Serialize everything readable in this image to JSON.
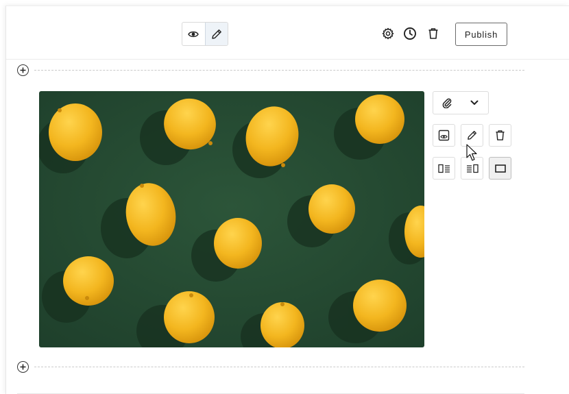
{
  "toolbar": {
    "publish_label": "Publish",
    "mode": "edit"
  },
  "icons": {
    "preview": "eye-icon",
    "edit": "pencil-icon",
    "settings": "gear-icon",
    "history": "clock-icon",
    "delete": "trash-icon",
    "add_block": "plus-circle-icon",
    "attachment": "paperclip-icon",
    "dropdown": "chevron-down-icon",
    "image_preview": "image-preview-icon",
    "image_edit": "pencil-icon",
    "image_delete": "trash-icon",
    "layout_left": "align-image-left-icon",
    "layout_right": "align-image-right-icon",
    "layout_full": "full-width-icon"
  },
  "image_block": {
    "layout_selected": "full-width"
  },
  "colors": {
    "photo_background": "#244a33",
    "lemon": "#f3b61f",
    "active_tab": "#eef3f8"
  }
}
